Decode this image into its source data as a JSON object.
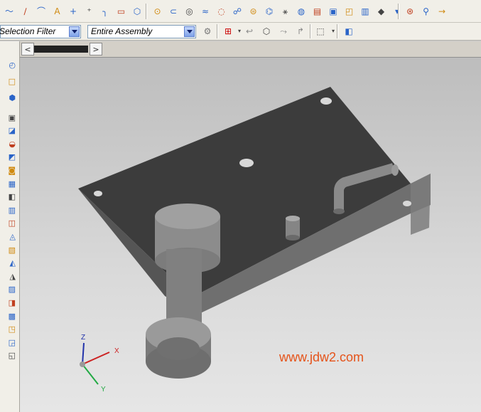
{
  "toolbar_icons_row1": [
    "sketch-curve-icon",
    "line-icon",
    "arc-icon",
    "text-icon",
    "point-icon",
    "point-set-icon",
    "fillet-corner-icon",
    "rectangle-icon",
    "polygon-icon",
    "circle-icon",
    "offset-curve-icon",
    "helix-icon",
    "law-curve-icon",
    "extract-curve-icon",
    "sweep-icon",
    "isoparametric-icon",
    "section-curve-icon",
    "intersection-curve-icon",
    "curve-on-surface-icon",
    "wrap-curve-icon",
    "bridge-curve-icon",
    "project-curve-icon",
    "combined-projection-icon",
    "feature-icon",
    "more-dropdown-icon",
    "undo-view-icon",
    "zoom-icon",
    "trim-icon"
  ],
  "selection_bar": {
    "filter_value": "Selection Filter",
    "scope_value": "Entire Assembly",
    "icons": [
      "filter-options-icon",
      "snap-point-icon",
      "undo-select-icon",
      "select-body-icon",
      "select-face-icon",
      "select-edge-icon",
      "select-rectangle-icon",
      "view-cube-icon"
    ]
  },
  "left_toolbar_icons": [
    "orient-view-icon",
    "display-mode-icon",
    "layer-icon",
    "part-block-icon",
    "extrude-icon",
    "revolve-icon",
    "hole-icon",
    "boss-icon",
    "pocket-icon",
    "pad-icon",
    "slot-icon",
    "groove-icon",
    "blend-icon",
    "chamfer-icon",
    "shell-icon",
    "taper-icon",
    "offset-face-icon",
    "scale-icon",
    "trim-body-icon",
    "split-body-icon",
    "sew-icon",
    "patch-icon"
  ],
  "tab_nav": {
    "prev": "<",
    "next": ">"
  },
  "viewport": {
    "watermark": "www.jdw2.com",
    "triad": {
      "z": "Z",
      "x": "X",
      "y": "Y"
    }
  },
  "colors": {
    "toolbar_bg": "#f1efe8",
    "model_top": "#3c3c3c",
    "model_side": "#6f6f6f",
    "watermark": "#e5531a"
  }
}
